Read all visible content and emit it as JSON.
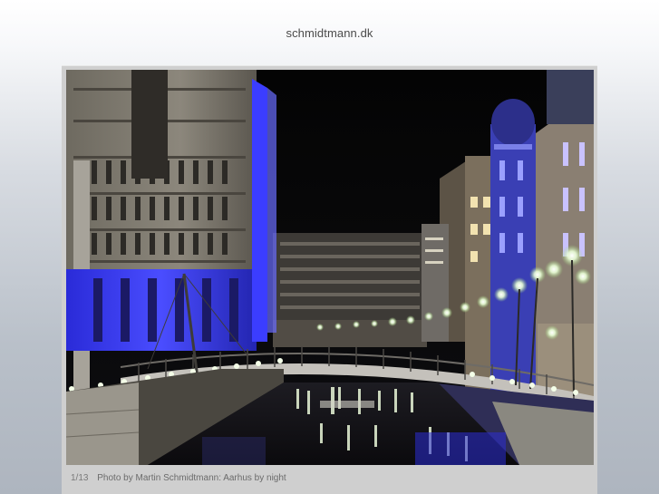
{
  "site": {
    "title": "schmidtmann.dk"
  },
  "gallery": {
    "counter": "1/13",
    "caption": "Photo by Martin Schmidtmann: Aarhus by night",
    "photo_subject": "night-canal-city-photo"
  },
  "colors": {
    "frame": "#cfcfcf",
    "caption_text": "#6b6b6b",
    "title_text": "#4a4a4a",
    "night_light_blue": "#3a3cff"
  }
}
